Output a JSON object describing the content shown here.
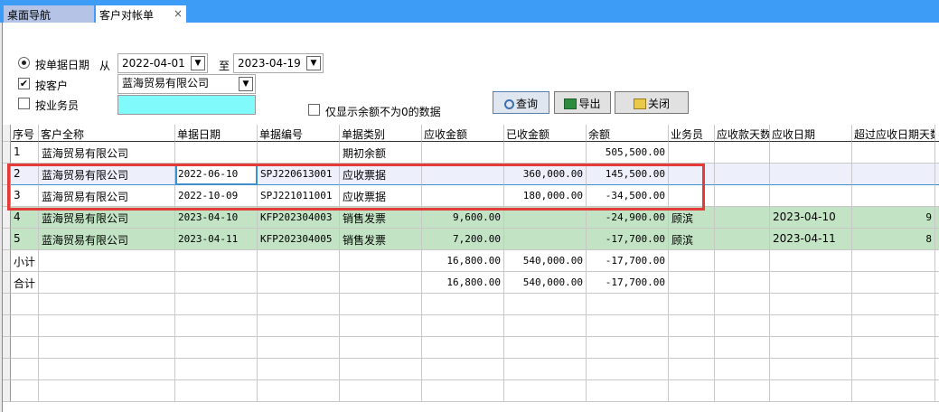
{
  "tabs": [
    {
      "label": "桌面导航"
    },
    {
      "label": "客户对帐单",
      "close": "×"
    }
  ],
  "filters": {
    "by_date_label": "按单据日期",
    "from_label": "从",
    "from_date": "2022-04-01",
    "to_label": "至",
    "to_date": "2023-04-19",
    "by_customer_label": "按客户",
    "customer_value": "蓝海贸易有限公司",
    "by_salesman_label": "按业务员",
    "salesman_value": "",
    "nonzero_label": "仅显示余额不为0的数据"
  },
  "buttons": {
    "query": "查询",
    "export": "导出",
    "close": "关闭"
  },
  "columns": [
    "序号",
    "客户全称",
    "单据日期",
    "单据编号",
    "单据类别",
    "应收金额",
    "已收金额",
    "余额",
    "业务员",
    "应收款天数",
    "应收日期",
    "超过应收日期天数"
  ],
  "rows": [
    [
      "1",
      "蓝海贸易有限公司",
      "",
      "",
      "期初余额",
      "",
      "",
      "505,500.00",
      "",
      "",
      "",
      ""
    ],
    [
      "2",
      "蓝海贸易有限公司",
      "2022-06-10",
      "SPJ220613001",
      "应收票据",
      "",
      "360,000.00",
      "145,500.00",
      "",
      "",
      "",
      ""
    ],
    [
      "3",
      "蓝海贸易有限公司",
      "2022-10-09",
      "SPJ221011001",
      "应收票据",
      "",
      "180,000.00",
      "-34,500.00",
      "",
      "",
      "",
      ""
    ],
    [
      "4",
      "蓝海贸易有限公司",
      "2023-04-10",
      "KFP202304003",
      "销售发票",
      "9,600.00",
      "",
      "-24,900.00",
      "顾滨",
      "",
      "2023-04-10",
      "9"
    ],
    [
      "5",
      "蓝海贸易有限公司",
      "2023-04-11",
      "KFP202304005",
      "销售发票",
      "7,200.00",
      "",
      "-17,700.00",
      "顾滨",
      "",
      "2023-04-11",
      "8"
    ],
    [
      "小计",
      "",
      "",
      "",
      "",
      "16,800.00",
      "540,000.00",
      "-17,700.00",
      "",
      "",
      "",
      ""
    ],
    [
      "合计",
      "",
      "",
      "",
      "",
      "16,800.00",
      "540,000.00",
      "-17,700.00",
      "",
      "",
      "",
      ""
    ]
  ]
}
